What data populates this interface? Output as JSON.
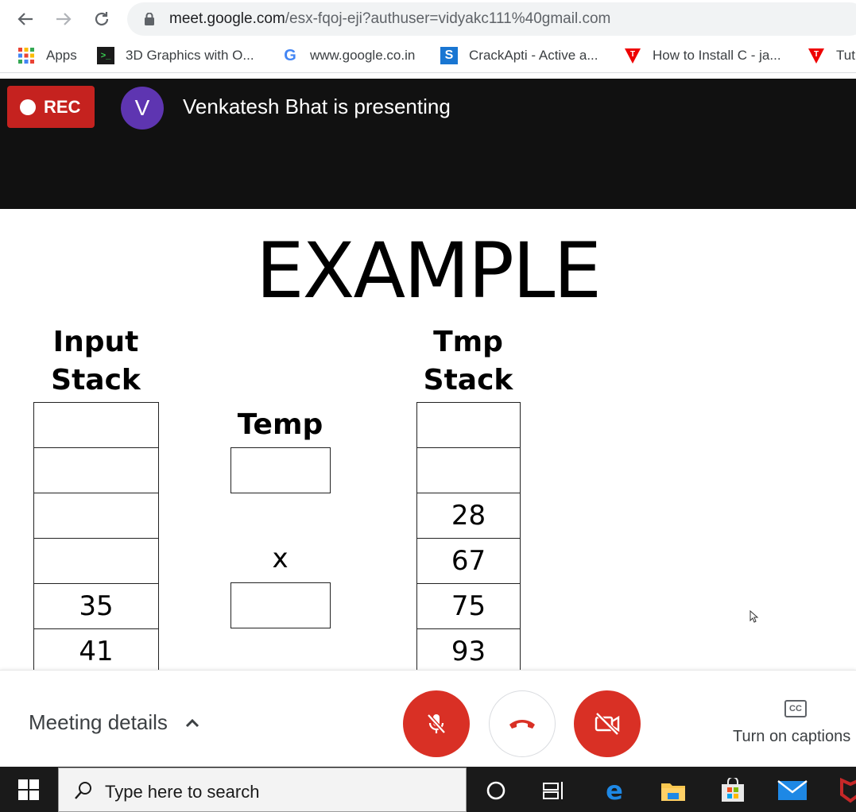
{
  "browser": {
    "url_host": "meet.google.com",
    "url_path": "/esx-fqoj-eji?authuser=vidyakc111%40gmail.com",
    "bookmarks": [
      {
        "label": "Apps",
        "icon": "apps-grid-icon"
      },
      {
        "label": "3D Graphics with O...",
        "icon": "hackerrank-icon"
      },
      {
        "label": "www.google.co.in",
        "icon": "google-icon"
      },
      {
        "label": "CrackApti - Active a...",
        "icon": "crackapti-icon"
      },
      {
        "label": "How to Install C - ja...",
        "icon": "tutorial-icon"
      },
      {
        "label": "Tut",
        "icon": "tutorial-icon"
      }
    ]
  },
  "meet": {
    "rec_label": "REC",
    "avatar_letter": "V",
    "presenting_text": "Venkatesh Bhat is presenting",
    "meeting_details_label": "Meeting details",
    "captions_label": "Turn on captions",
    "colors": {
      "rec": "#c5221f",
      "avatar": "#5e35b1",
      "danger": "#d93025"
    }
  },
  "slide": {
    "title": "EXAMPLE",
    "input_stack": {
      "heading_line1": "Input",
      "heading_line2": "Stack",
      "cells": [
        "",
        "",
        "",
        "",
        "35",
        "41"
      ]
    },
    "temp": {
      "heading": "Temp",
      "value": ""
    },
    "x": {
      "label": "x",
      "value": ""
    },
    "tmp_stack": {
      "heading_line1": "Tmp",
      "heading_line2": "Stack",
      "cells": [
        "",
        "",
        "28",
        "67",
        "75",
        "93"
      ]
    }
  },
  "taskbar": {
    "search_placeholder": "Type here to search"
  }
}
